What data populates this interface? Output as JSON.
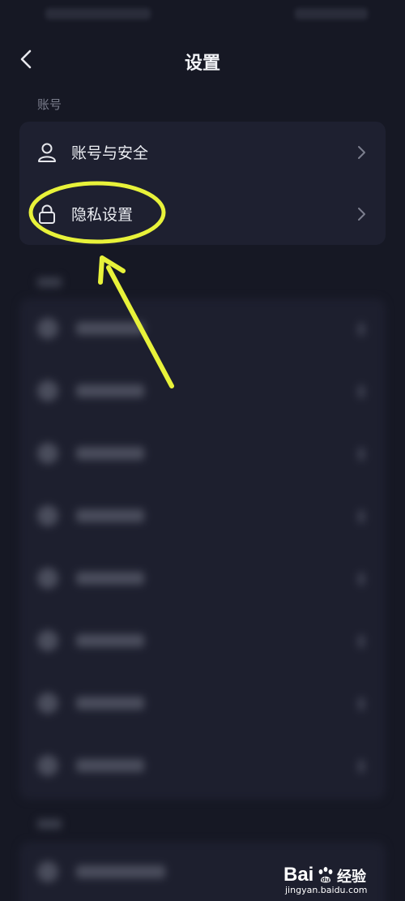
{
  "nav": {
    "title": "设置",
    "back_icon": "chevron-left-icon"
  },
  "account_section": {
    "label": "账号",
    "items": [
      {
        "label": "账号与安全",
        "icon": "user-icon"
      },
      {
        "label": "隐私设置",
        "icon": "lock-icon"
      }
    ]
  },
  "annotation": {
    "color": "#e8f23a",
    "shape": "ellipse-highlight-with-arrow"
  },
  "watermark": {
    "logo_text": "Bai",
    "logo_text_2": "du",
    "brand_cn": "经验",
    "url": "jingyan.baidu.com"
  },
  "colors": {
    "background": "#161824",
    "card": "#1e2030",
    "text": "#eceef3",
    "muted": "#7a7d8c"
  }
}
